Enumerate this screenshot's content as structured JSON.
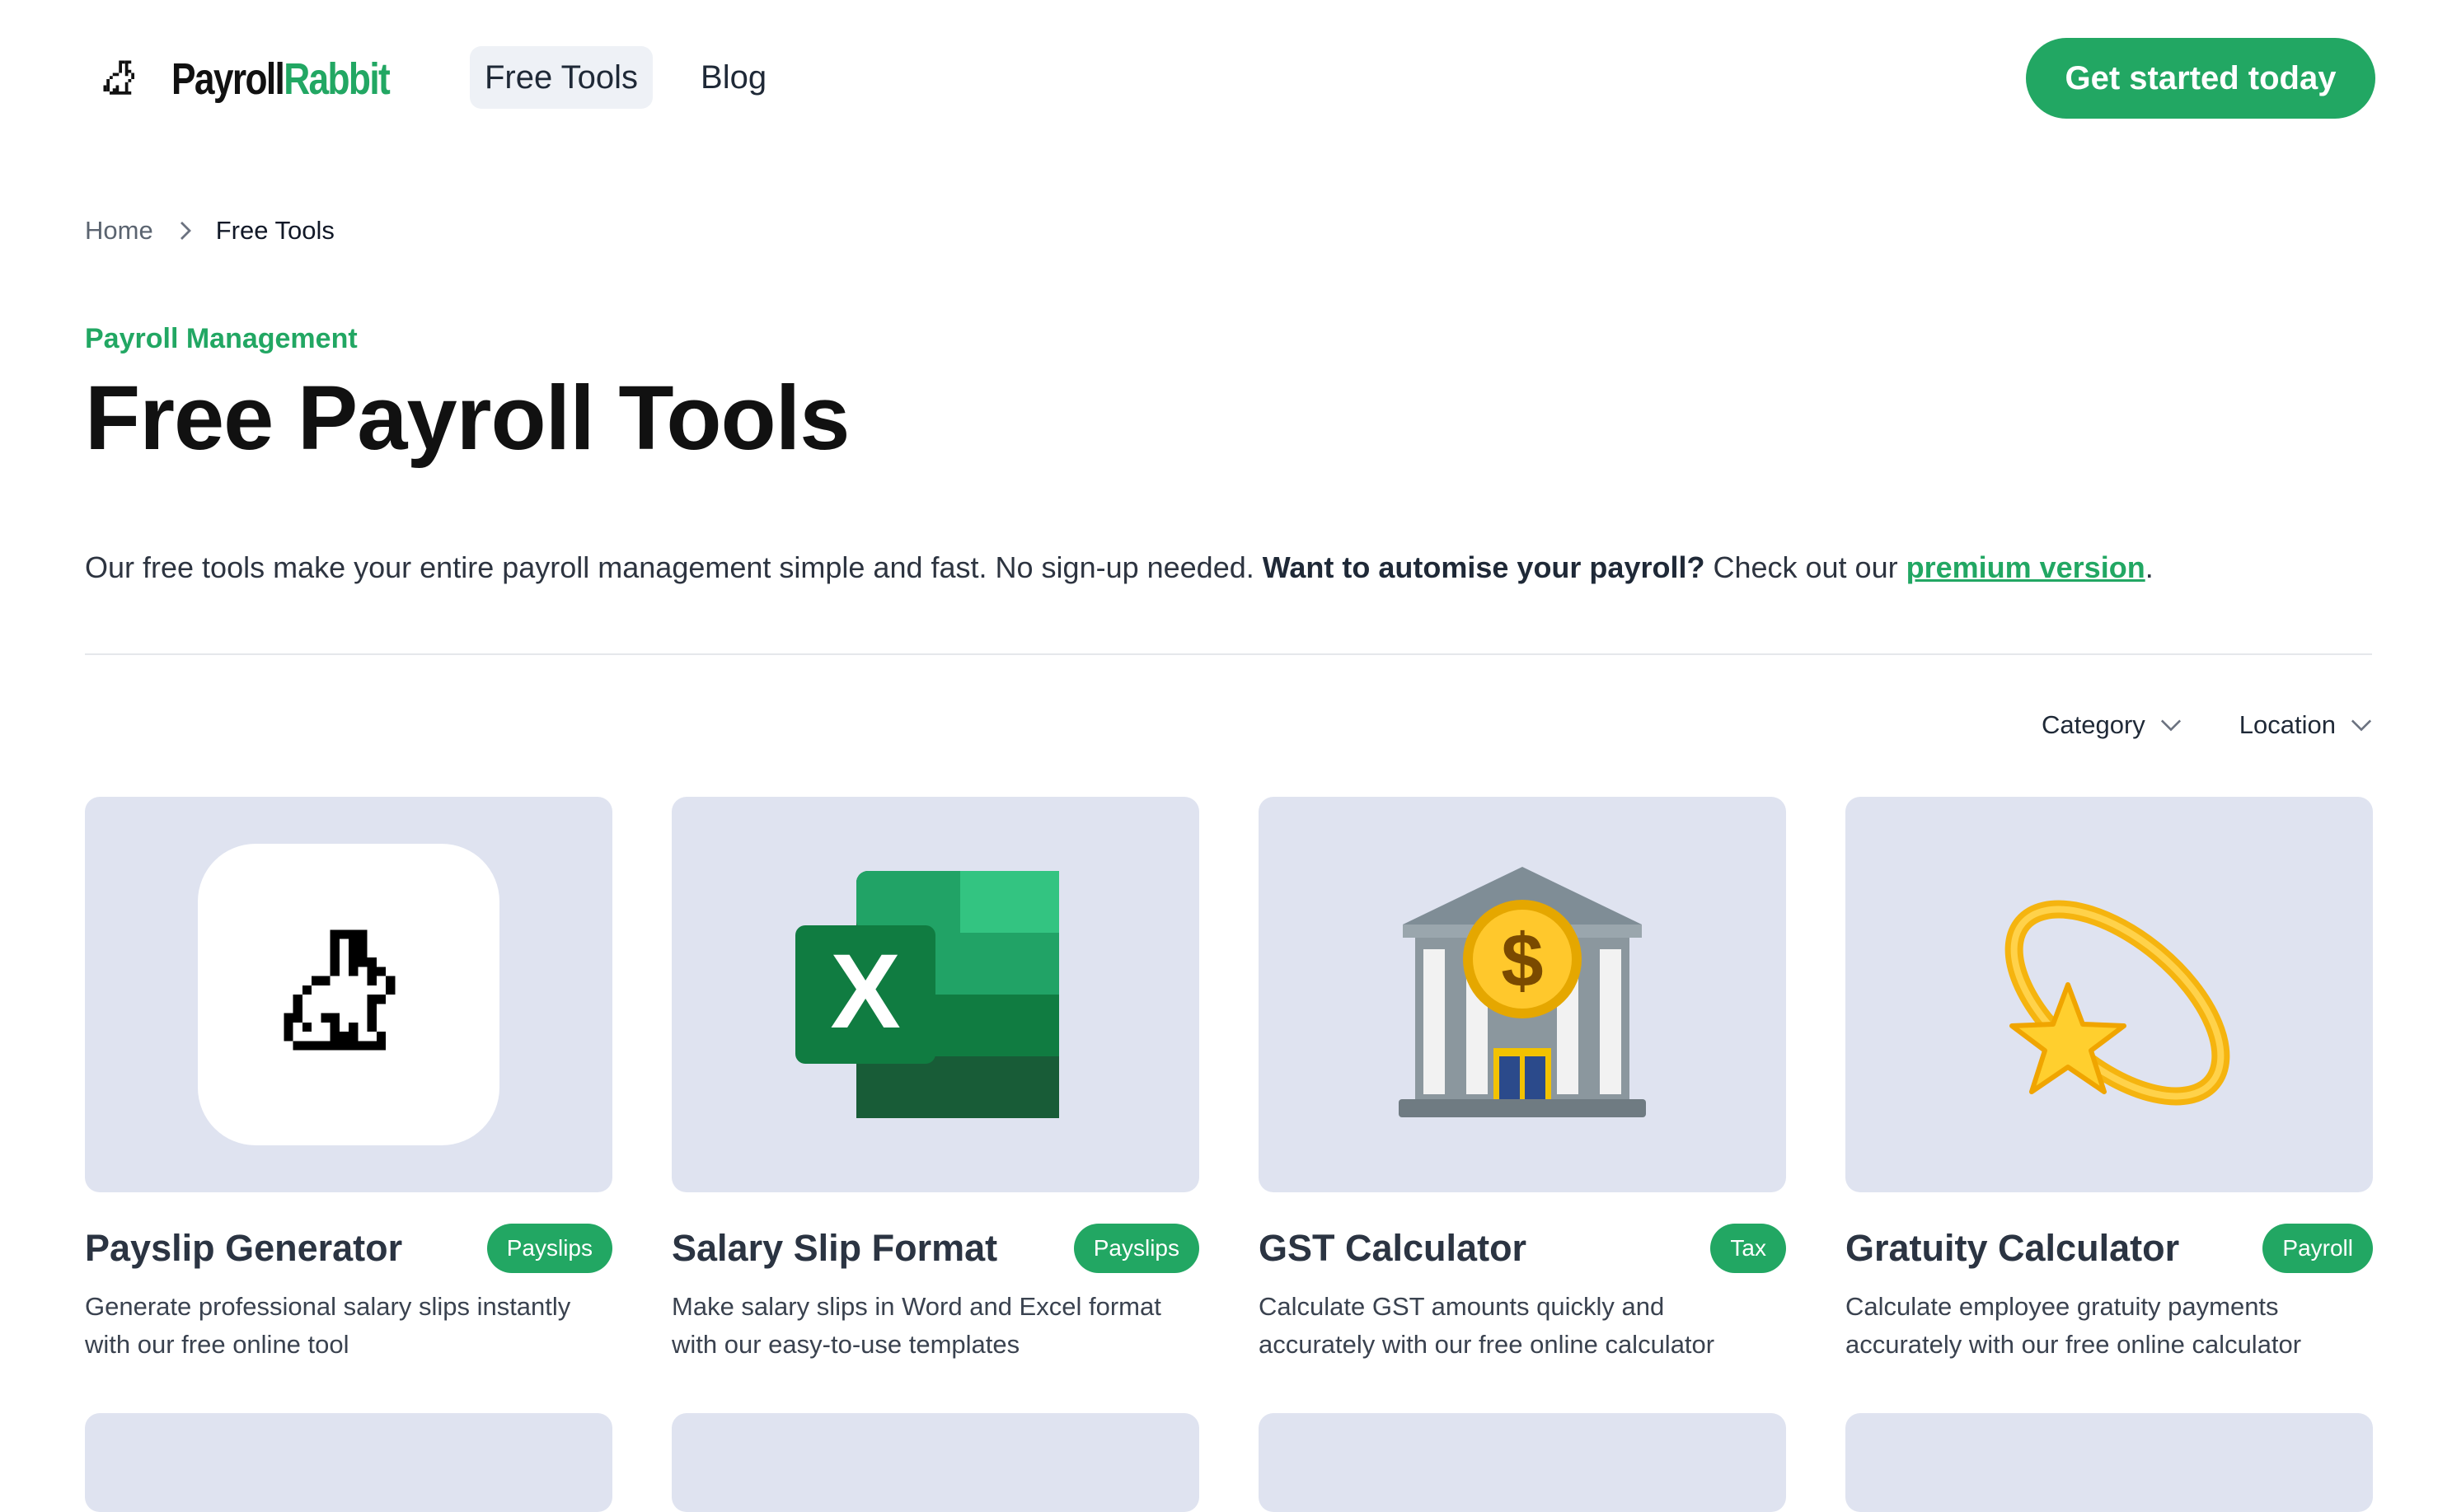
{
  "header": {
    "logo_part1": "Payroll",
    "logo_part2": "Rabbit",
    "nav": [
      {
        "label": "Free Tools",
        "active": true
      },
      {
        "label": "Blog",
        "active": false
      }
    ],
    "cta_label": "Get started today"
  },
  "breadcrumb": {
    "home": "Home",
    "current": "Free Tools"
  },
  "hero": {
    "eyebrow": "Payroll Management",
    "title": "Free Payroll Tools",
    "intro_plain": "Our free tools make your entire payroll management simple and fast. No sign-up needed. ",
    "intro_bold": "Want to automise your payroll?",
    "intro_after": " Check out our ",
    "intro_link": "premium version",
    "intro_end": "."
  },
  "filters": {
    "category": "Category",
    "location": "Location"
  },
  "cards": [
    {
      "title": "Payslip Generator",
      "badge": "Payslips",
      "desc": "Generate professional salary slips instantly with our free online tool",
      "icon": "rabbit-icon"
    },
    {
      "title": "Salary Slip Format",
      "badge": "Payslips",
      "desc": "Make salary slips in Word and Excel format with our easy-to-use templates",
      "icon": "excel-icon"
    },
    {
      "title": "GST Calculator",
      "badge": "Tax",
      "desc": "Calculate GST amounts quickly and accurately with our free online calculator",
      "icon": "bank-icon"
    },
    {
      "title": "Gratuity Calculator",
      "badge": "Payroll",
      "desc": "Calculate employee gratuity payments accurately with our free online calculator",
      "icon": "shooting-star-icon"
    }
  ],
  "colors": {
    "brand_green": "#22a763",
    "card_bg": "#dfe3f0"
  }
}
